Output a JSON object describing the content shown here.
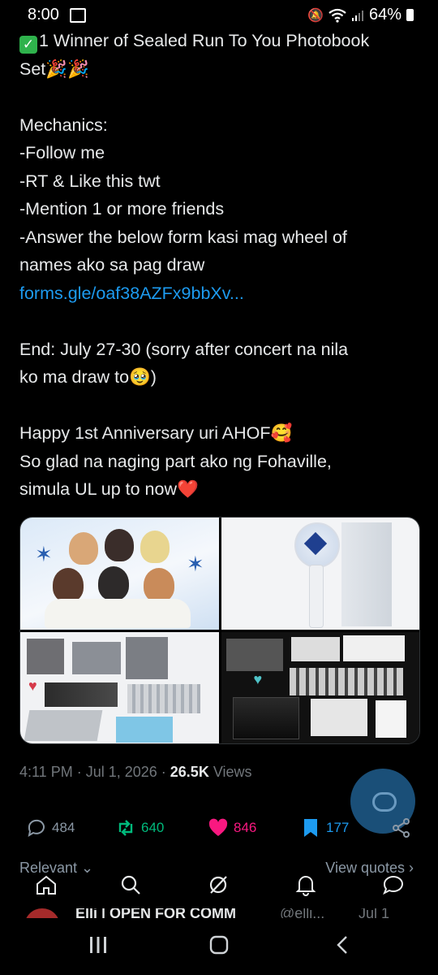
{
  "status_bar": {
    "time": "8:00",
    "battery": "64%"
  },
  "tweet": {
    "lines": [
      "1 Winner of Sealed Run To You Photobook",
      "Set🎉🎉",
      "",
      "Mechanics:",
      "-Follow me",
      "-RT & Like this twt",
      "-Mention 1 or more friends",
      "-Answer the below form kasi mag wheel of",
      "names ako sa pag draw",
      "forms.gle/oaf38AZFx9bbXv...",
      "",
      "End: July 27-30 (sorry after concert na nila",
      "ko ma draw to🥹)",
      "",
      "Happy 1st Anniversary uri AHOF🥰",
      "So glad na naging part ako ng Fohaville,",
      "simula UL up to now❤️"
    ]
  },
  "meta": {
    "time": "4:11 PM",
    "sep1": " · ",
    "date": "Jul 1, 2026",
    "sep2": " · ",
    "views": "26.5K",
    "views_label": " Views"
  },
  "actions": {
    "replies": "484",
    "reposts": "640",
    "likes": "846",
    "bookmarks": "177"
  },
  "colors": {
    "accent": "#1d9bf0",
    "repost": "#00ba7c",
    "like": "#f91880"
  },
  "sort_label": "Relevant",
  "view_quotes_label": "View quotes",
  "reply_preview": {
    "name": "Elli | OPEN FOR COMM",
    "handle": "@elli...",
    "date": "Jul 1"
  }
}
